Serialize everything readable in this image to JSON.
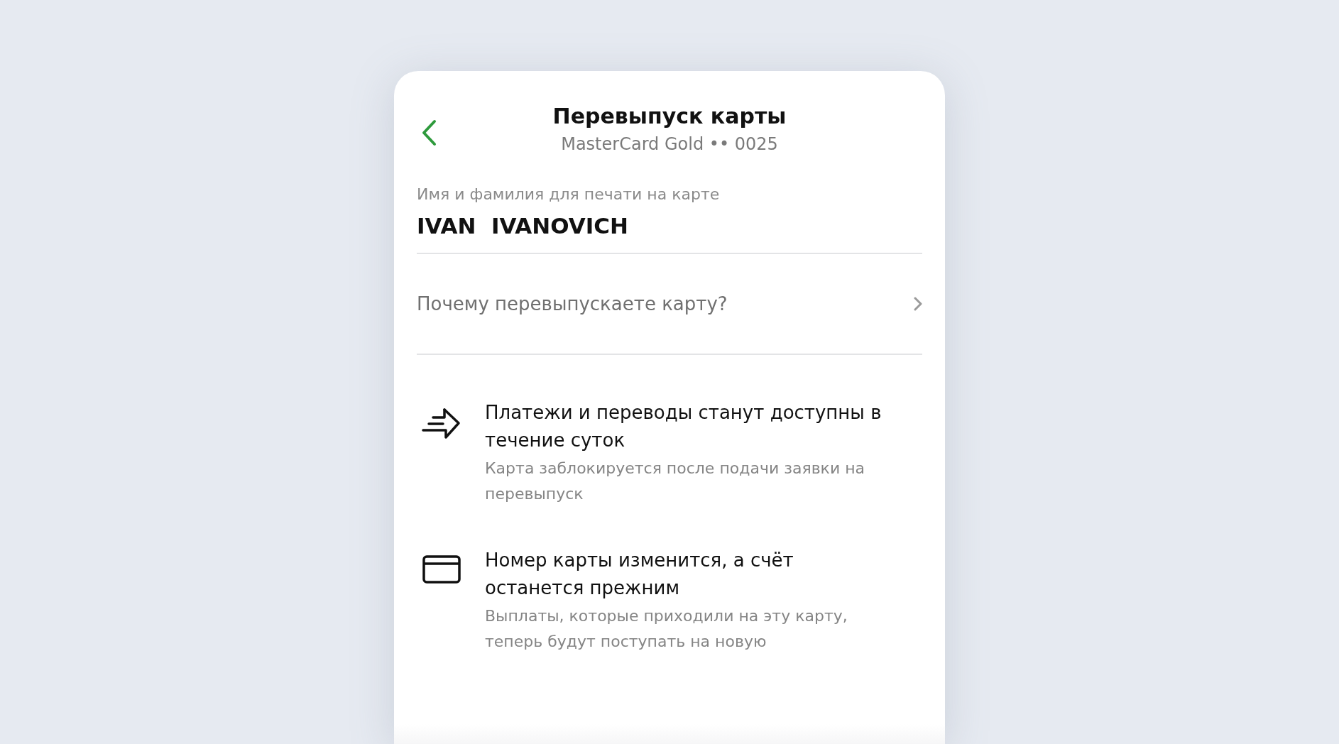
{
  "header": {
    "title": "Перевыпуск карты",
    "subtitle": "MasterCard Gold •• 0025"
  },
  "name_field": {
    "label": "Имя и фамилия для печати на карте",
    "value": "IVAN  IVANOVICH"
  },
  "reason_row": {
    "placeholder": "Почему перевыпускаете карту?"
  },
  "notices": [
    {
      "kind": "transfer",
      "title": "Платежи и переводы станут доступны в течение суток",
      "text": "Карта заблокируется после подачи заявки на перевыпуск"
    },
    {
      "kind": "card",
      "title": "Номер карты изменится, а счёт останется прежним",
      "text": "Выплаты, которые приходили на эту карту, теперь будут поступать на новую"
    }
  ]
}
